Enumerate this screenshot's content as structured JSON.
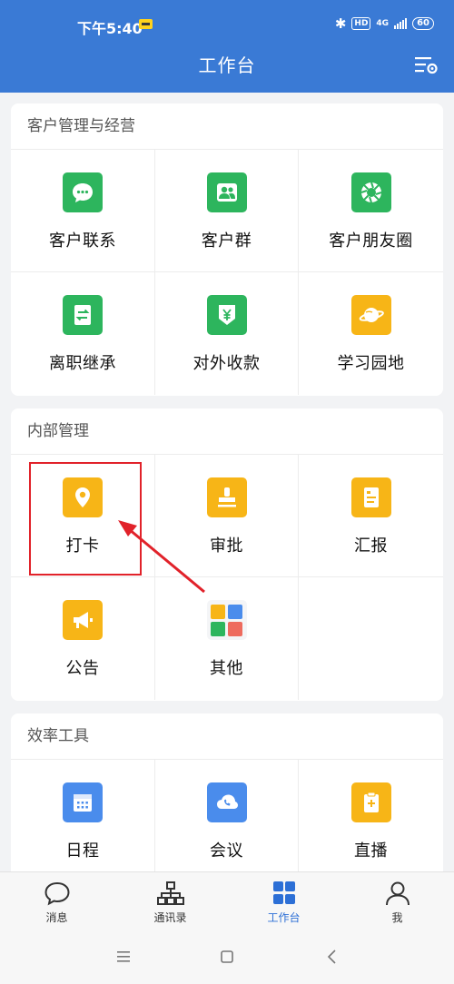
{
  "status_bar": {
    "time": "下午5:40",
    "hd": "HD",
    "network": "4G",
    "battery": "60"
  },
  "header": {
    "title": "工作台",
    "settings_icon": "settings-list-icon"
  },
  "sections": [
    {
      "title": "客户管理与经营",
      "items": [
        {
          "label": "客户联系",
          "icon": "chat-bubble-icon",
          "color": "#2db55d"
        },
        {
          "label": "客户群",
          "icon": "group-people-icon",
          "color": "#2db55d"
        },
        {
          "label": "客户朋友圈",
          "icon": "aperture-icon",
          "color": "#2db55d"
        },
        {
          "label": "离职继承",
          "icon": "transfer-doc-icon",
          "color": "#2db55d"
        },
        {
          "label": "对外收款",
          "icon": "yen-shield-icon",
          "color": "#2db55d"
        },
        {
          "label": "学习园地",
          "icon": "planet-icon",
          "color": "#f7b517"
        }
      ]
    },
    {
      "title": "内部管理",
      "items": [
        {
          "label": "打卡",
          "icon": "location-pin-icon",
          "color": "#f7b517"
        },
        {
          "label": "审批",
          "icon": "stamp-icon",
          "color": "#f7b517"
        },
        {
          "label": "汇报",
          "icon": "report-doc-icon",
          "color": "#f7b517"
        },
        {
          "label": "公告",
          "icon": "megaphone-icon",
          "color": "#f7b517"
        },
        {
          "label": "其他",
          "icon": "app-grid-icon",
          "color": "#f4f5f7"
        }
      ]
    },
    {
      "title": "效率工具",
      "items": [
        {
          "label": "日程",
          "icon": "calendar-icon",
          "color": "#4a8cec"
        },
        {
          "label": "会议",
          "icon": "cloud-phone-icon",
          "color": "#4a8cec"
        },
        {
          "label": "直播",
          "icon": "clipboard-plus-icon",
          "color": "#f7b517"
        }
      ]
    }
  ],
  "tabbar": [
    {
      "label": "消息",
      "icon": "message-bubble-icon"
    },
    {
      "label": "通讯录",
      "icon": "org-chart-icon"
    },
    {
      "label": "工作台",
      "icon": "workbench-grid-icon",
      "active": true
    },
    {
      "label": "我",
      "icon": "person-icon"
    }
  ],
  "nav": {
    "menu_icon": "menu-icon",
    "home_icon": "home-square-icon",
    "back_icon": "back-chevron-icon"
  },
  "colors": {
    "header": "#3a7ad5",
    "accent": "#2c6fd6",
    "highlight": "#e1222a"
  }
}
